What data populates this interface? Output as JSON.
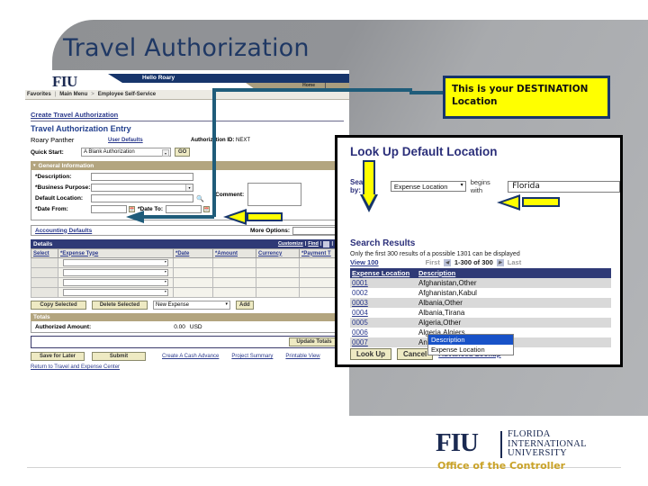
{
  "slide": {
    "title": "Travel Authorization"
  },
  "callout": {
    "line1": "This is your DESTINATION",
    "line2": "Location"
  },
  "peoplesoft": {
    "brand": "FIU",
    "greeting": "Hello Roary",
    "home_label": "Home",
    "breadcrumb": [
      "Favorites",
      "Main Menu",
      "Employee Self-Service"
    ],
    "breadcrumb_sep": ">",
    "create_link": "Create Travel Authorization",
    "entry_title": "Travel Authorization Entry",
    "employee_name": "Roary Panther",
    "user_defaults_link": "User Defaults",
    "auth_id_label": "Authorization ID:",
    "auth_id_value": "NEXT",
    "quick_start_label": "Quick Start:",
    "quick_start_value": "A Blank Authorization",
    "go_button": "GO",
    "general_info_section": "General Information",
    "fields": {
      "description_label": "*Description:",
      "description_value": "",
      "business_purpose_label": "*Business Purpose:",
      "business_purpose_value": "",
      "default_location_label": "Default Location:",
      "default_location_value": "",
      "date_from_label": "*Date From:",
      "date_from_value": "",
      "date_to_label": "*Date To:",
      "date_to_value": "",
      "comment_label": "Comment:",
      "comment_value": ""
    },
    "accounting_defaults_link": "Accounting Defaults",
    "more_options_label": "More Options:",
    "more_options_value": "",
    "details_section": "Details",
    "details_tools": [
      "Customize",
      "Find"
    ],
    "details_columns": [
      "Select",
      "*Expense Type",
      "*Date",
      "*Amount",
      "Currency",
      "*Payment T"
    ],
    "details_rows": 4,
    "copy_selected_button": "Copy Selected",
    "delete_selected_button": "Delete Selected",
    "new_expense_value": "New Expense",
    "add_button": "Add",
    "totals_section": "Totals",
    "authorized_amount_label": "Authorized Amount:",
    "authorized_amount_value": "0.00",
    "authorized_amount_currency": "USD",
    "update_totals_button": "Update Totals",
    "save_for_later_button": "Save for Later",
    "submit_button": "Submit",
    "footer_links": [
      "Create A Cash Advance",
      "Project Summary",
      "Printable View"
    ],
    "return_link": "Return to Travel and Expense Center"
  },
  "lookup": {
    "title": "Look Up Default Location",
    "search_by_label": "Search by:",
    "search_by_value": "Expense Location",
    "operator": "begins with",
    "search_value": "Florida",
    "dropdown_options": [
      "Description",
      "Expense Location"
    ],
    "dropdown_selected": "Description",
    "look_up_button": "Look Up",
    "cancel_button": "Cancel",
    "advanced_lookup_link": "Advanced Lookup",
    "results_title": "Search Results",
    "results_note": "Only the first 300 results of a possible 1301 can be displayed",
    "view_link": "View 100",
    "pager_first": "First",
    "pager_range": "1-300 of 300",
    "pager_last": "Last",
    "columns": [
      "Expense Location",
      "Description"
    ],
    "rows": [
      {
        "code": "0001",
        "description": "Afghanistan,Other"
      },
      {
        "code": "0002",
        "description": "Afghanistan,Kabul"
      },
      {
        "code": "0003",
        "description": "Albania,Other"
      },
      {
        "code": "0004",
        "description": "Albania,Tirana"
      },
      {
        "code": "0005",
        "description": "Algeria,Other"
      },
      {
        "code": "0006",
        "description": "Algeria,Algiers"
      },
      {
        "code": "0007",
        "description": "Andorra,Andorra"
      }
    ]
  },
  "footer": {
    "mark": "FIU",
    "line1": "FLORIDA",
    "line2": "INTERNATIONAL",
    "line3": "UNIVERSITY",
    "office": "Office of the Controller"
  },
  "colors": {
    "navy": "#17356b",
    "callout_yellow": "#ffff00",
    "ps_blue_bar": "#2f3a76",
    "ps_tan_bar": "#b3a57f",
    "gold": "#c9a227"
  }
}
